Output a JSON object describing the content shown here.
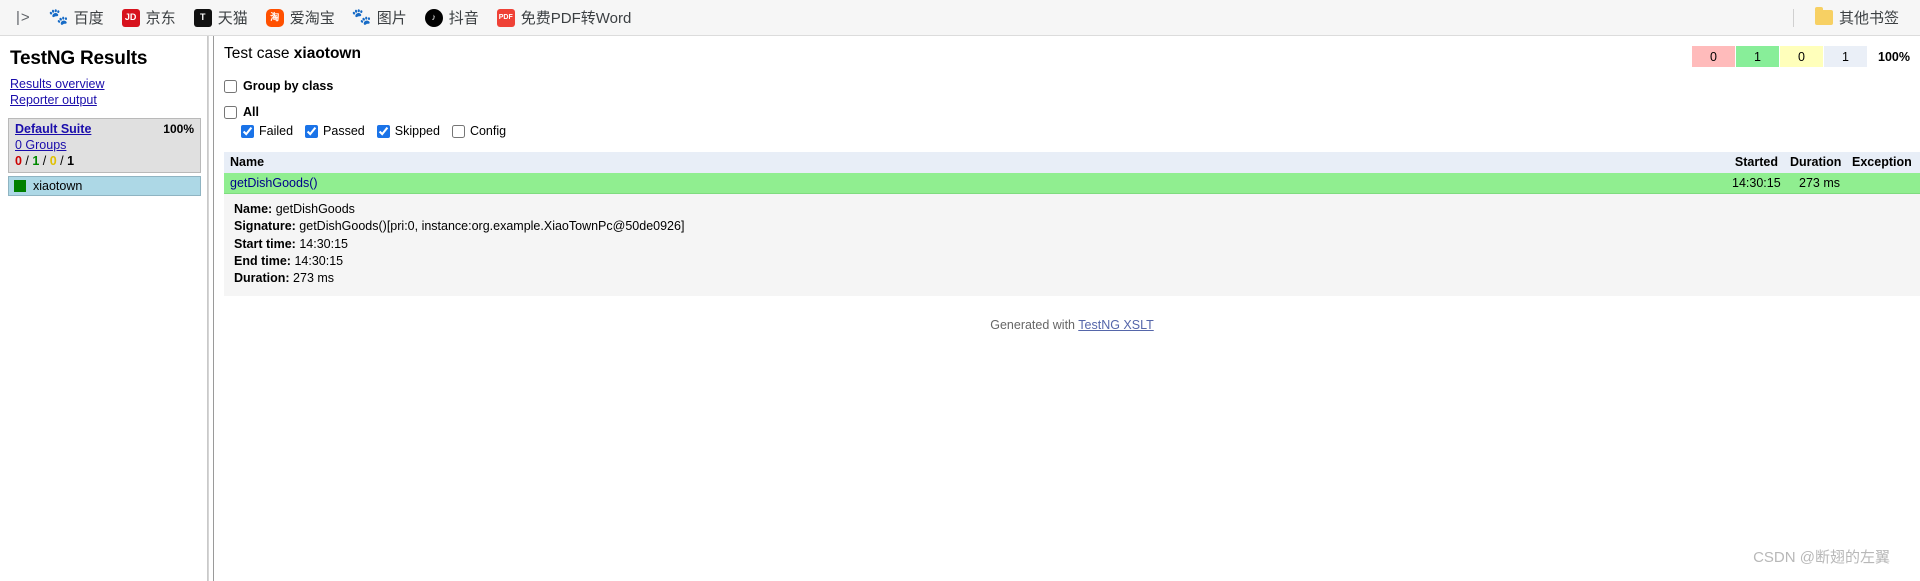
{
  "browser": {
    "apps_label": "|>",
    "bookmarks": [
      {
        "label": "百度",
        "icon": "baidu-icon",
        "icon_text": "🐾"
      },
      {
        "label": "京东",
        "icon": "jd-icon",
        "icon_text": "JD"
      },
      {
        "label": "天猫",
        "icon": "tmall-icon",
        "icon_text": "T"
      },
      {
        "label": "爱淘宝",
        "icon": "taobao-icon",
        "icon_text": "淘"
      },
      {
        "label": "图片",
        "icon": "baidu-icon",
        "icon_text": "🐾"
      },
      {
        "label": "抖音",
        "icon": "douyin-icon",
        "icon_text": "♪"
      },
      {
        "label": "免费PDF转Word",
        "icon": "pdf-icon",
        "icon_text": "PDF"
      }
    ],
    "other_bookmarks": "其他书签"
  },
  "sidebar": {
    "title": "TestNG Results",
    "links": [
      {
        "label": "Results overview"
      },
      {
        "label": "Reporter output"
      }
    ],
    "suite": {
      "name": "Default Suite",
      "percent": "100%",
      "groups": "0 Groups",
      "counts": {
        "failed": "0",
        "passed": "1",
        "skipped": "0",
        "total": "1",
        "separator": "/"
      }
    },
    "tests": [
      {
        "name": "xiaotown",
        "status_color": "#008000"
      }
    ]
  },
  "main": {
    "title_prefix": "Test case ",
    "title_name": "xiaotown",
    "summary": {
      "failed": "0",
      "passed": "1",
      "skipped": "0",
      "total": "1",
      "percent": "100%",
      "colors": {
        "failed": "#ffbbbb",
        "passed": "#88ee99",
        "skipped": "#ffffbb",
        "total": "#eaeff7"
      }
    },
    "options": {
      "group_by_class": {
        "label": "Group by class",
        "checked": false
      },
      "all": {
        "label": "All",
        "checked": false
      },
      "filters": [
        {
          "label": "Failed",
          "checked": true
        },
        {
          "label": "Passed",
          "checked": true
        },
        {
          "label": "Skipped",
          "checked": true
        },
        {
          "label": "Config",
          "checked": false
        }
      ]
    },
    "table": {
      "headers": {
        "name": "Name",
        "started": "Started",
        "duration": "Duration",
        "exception": "Exception"
      },
      "rows": [
        {
          "name": "getDishGoods()",
          "started": "14:30:15",
          "duration": "273 ms",
          "exception": "",
          "details": {
            "name_label": "Name:",
            "name_value": "getDishGoods",
            "signature_label": "Signature:",
            "signature_value": "getDishGoods()[pri:0, instance:org.example.XiaoTownPc@50de0926]",
            "start_label": "Start time:",
            "start_value": "14:30:15",
            "end_label": "End time:",
            "end_value": "14:30:15",
            "duration_label": "Duration:",
            "duration_value": "273 ms"
          }
        }
      ]
    },
    "footer": {
      "text": "Generated with ",
      "link": "TestNG XSLT"
    }
  },
  "watermark": "CSDN @断翅的左翼"
}
